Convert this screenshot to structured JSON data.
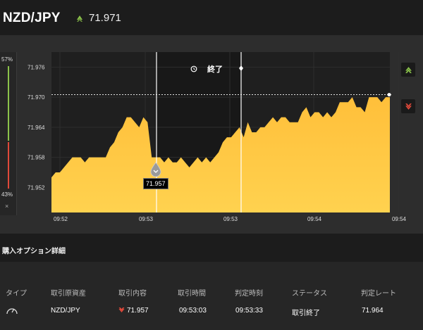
{
  "header": {
    "symbol": "NZD/JPY",
    "rate": "71.971",
    "direction_icon": "up-arrow-icon",
    "up_color": "#8bc34a",
    "down_color": "#e0493a"
  },
  "gauge": {
    "top_pct": "57%",
    "bottom_pct": "43%",
    "close_label": "×",
    "top_value": 0.57,
    "bottom_value": 0.43
  },
  "chart": {
    "end_label": "終了",
    "history_icon": "history-icon",
    "price_tag": "71.957"
  },
  "chart_data": {
    "type": "area",
    "y_ticks": [
      "71.976",
      "71.970",
      "71.964",
      "71.958",
      "71.952"
    ],
    "x_ticks": [
      "09:52",
      "09:53",
      "09:53",
      "09:54",
      "09:54"
    ],
    "ylim": [
      71.947,
      71.979
    ],
    "current_rate": 71.9705,
    "area_color": "#ffc94a",
    "points": [
      71.954,
      71.955,
      71.955,
      71.956,
      71.957,
      71.958,
      71.958,
      71.958,
      71.957,
      71.958,
      71.958,
      71.958,
      71.958,
      71.958,
      71.96,
      71.961,
      71.963,
      71.964,
      71.966,
      71.966,
      71.965,
      71.964,
      71.966,
      71.965,
      71.958,
      71.958,
      71.958,
      71.957,
      71.958,
      71.957,
      71.957,
      71.958,
      71.957,
      71.956,
      71.957,
      71.958,
      71.957,
      71.958,
      71.957,
      71.958,
      71.959,
      71.961,
      71.962,
      71.962,
      71.963,
      71.964,
      71.962,
      71.965,
      71.963,
      71.963,
      71.964,
      71.964,
      71.965,
      71.966,
      71.965,
      71.966,
      71.966,
      71.965,
      71.965,
      71.965,
      71.967,
      71.968,
      71.966,
      71.967,
      71.967,
      71.966,
      71.967,
      71.966,
      71.967,
      71.969,
      71.969,
      71.969,
      71.97,
      71.968,
      71.968,
      71.967,
      71.97,
      71.97,
      71.97,
      71.969,
      71.97,
      71.97
    ],
    "vlines_x": [
      74,
      134
    ]
  },
  "section": {
    "title": "購入オプション詳細"
  },
  "table": {
    "headers": [
      "タイプ",
      "取引原資産",
      "取引内容",
      "取引時間",
      "判定時刻",
      "ステータス",
      "判定レート"
    ],
    "row": {
      "type_icon": "gauge-icon",
      "asset": "NZD/JPY",
      "content": "71.957",
      "content_icon": "down-arrow-icon",
      "time": "09:53:03",
      "judge_time": "09:53:33",
      "status": "取引終了",
      "judge_rate": "71.964"
    }
  }
}
